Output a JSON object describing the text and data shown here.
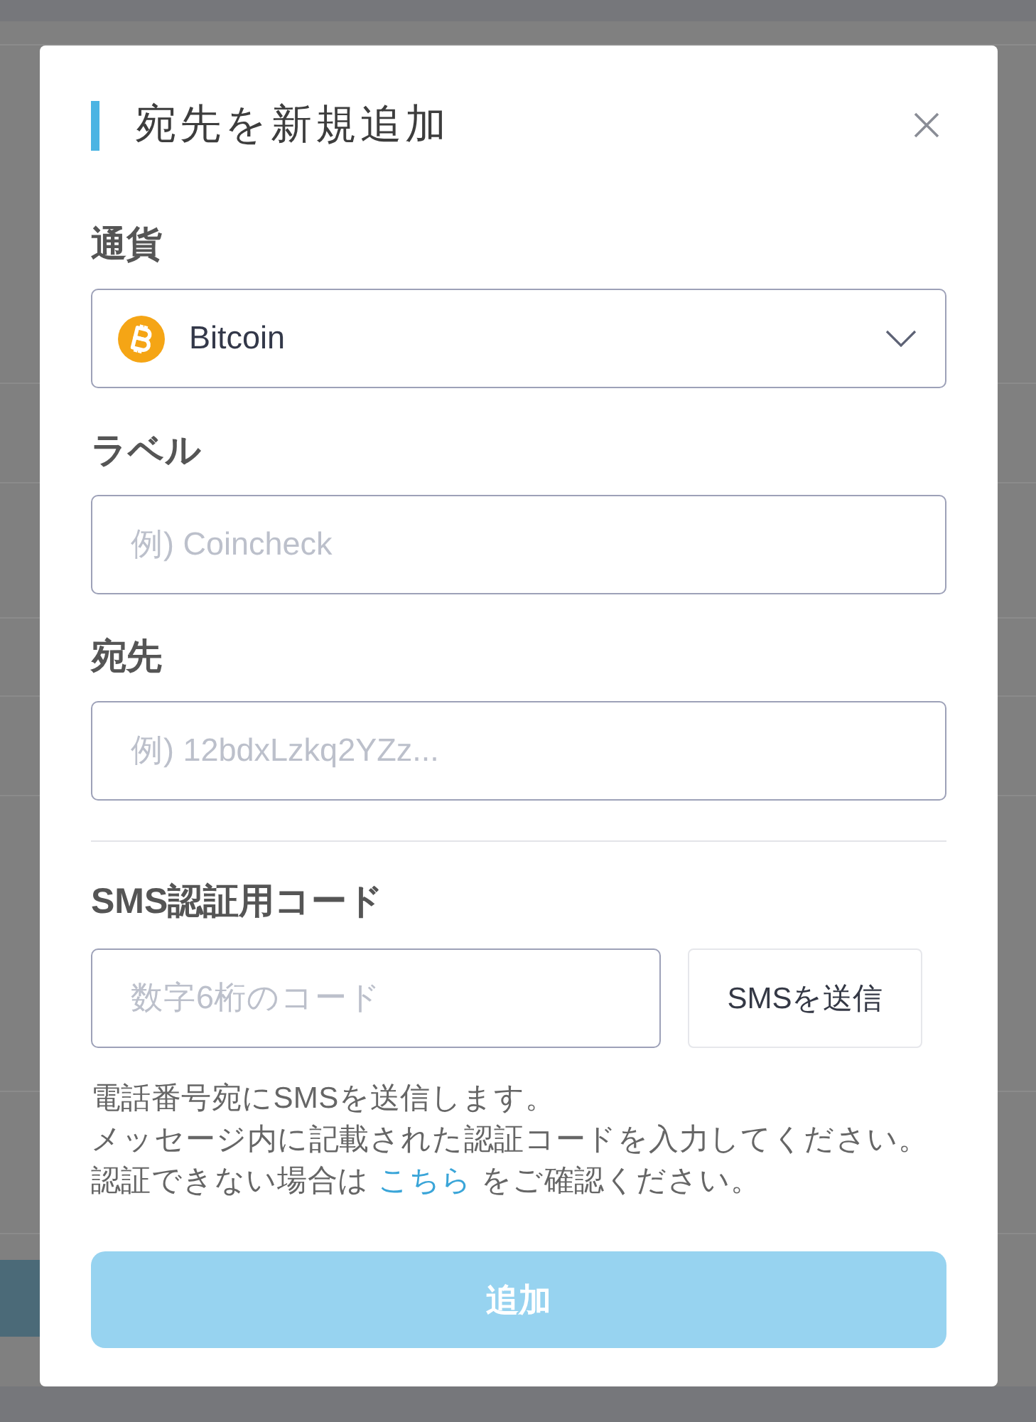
{
  "dialog": {
    "title": "宛先を新規追加"
  },
  "fields": [
    {
      "kind": "select",
      "label": "通貨",
      "value": "Bitcoin"
    },
    {
      "kind": "text",
      "label": "ラベル",
      "placeholder": "例) Coincheck"
    },
    {
      "kind": "text",
      "label": "宛先",
      "placeholder": "例) 12bdxLzkq2YZz..."
    }
  ],
  "sms": {
    "label": "SMS認証用コード",
    "placeholder": "数字6桁のコード",
    "button": "SMSを送信",
    "help_lines": [
      [
        {
          "kind": "text",
          "text": "電話番号宛にSMSを送信します。"
        }
      ],
      [
        {
          "kind": "text",
          "text": "メッセージ内に記載された認証コードを入力してください。"
        }
      ],
      [
        {
          "kind": "text",
          "text": "認証できない場合は "
        },
        {
          "kind": "link",
          "text": "こちら"
        },
        {
          "kind": "text",
          "text": " をご確認ください。"
        }
      ]
    ]
  },
  "submit_button": {
    "label": "追加",
    "disabled": true
  }
}
